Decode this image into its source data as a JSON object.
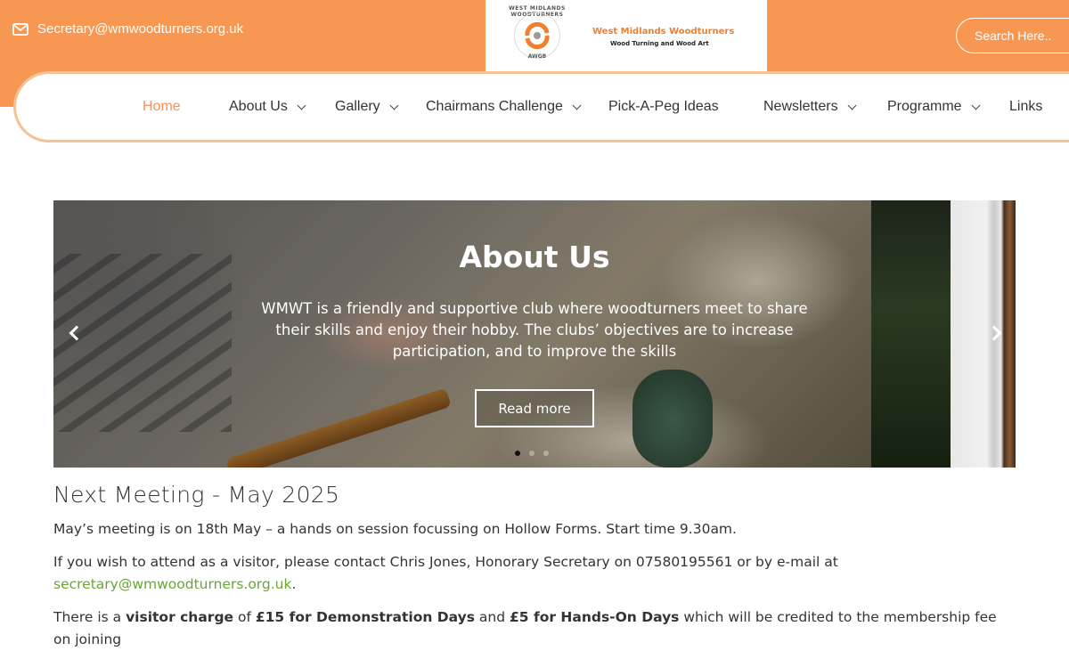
{
  "header": {
    "email": "Secretary@wmwoodturners.org.uk",
    "search_placeholder": "Search Here..",
    "logo": {
      "ring_top": "WEST MIDLANDS WOODTURNERS",
      "ring_bottom": "AWGB",
      "title": "West Midlands Woodturners",
      "subtitle": "Wood Turning and Wood Art"
    },
    "brand_color": "#f89752"
  },
  "nav": {
    "items": [
      {
        "label": "Home",
        "active": true,
        "dropdown": false
      },
      {
        "label": "About Us",
        "dropdown": true
      },
      {
        "label": "Gallery",
        "dropdown": true
      },
      {
        "label": "Chairmans Challenge",
        "dropdown": true
      },
      {
        "label": "Pick-A-Peg Ideas",
        "dropdown": false
      },
      {
        "label": "Newsletters",
        "dropdown": true
      },
      {
        "label": "Programme",
        "dropdown": true
      },
      {
        "label": "Links",
        "dropdown": false
      }
    ]
  },
  "hero": {
    "title": "About Us",
    "text": "WMWT is a friendly and supportive club where woodturners meet to share their skills and enjoy their hobby. The clubs’ objectives are to increase participation, and to improve the skills",
    "button": "Read more",
    "slides": 3,
    "active_slide": 1
  },
  "content": {
    "title": "Next Meeting - May 2025",
    "p1": "May’s meeting is on 18th May – a hands on session focussing on Hollow Forms. Start time 9.30am.",
    "p2_text": "If you wish to attend as a visitor, please contact Chris Jones, Honorary Secretary on 07580195561 or by e-mail at",
    "p2_link": "secretary@wmwoodturners.org.uk",
    "p2_end": ".",
    "p3": {
      "a": "There is a ",
      "b1": "visitor charge",
      "c": " of ",
      "b2": "£15 for Demonstration Days",
      "d": " and ",
      "b3": "£5 for Hands-On Days",
      "e": " which will be credited to the membership fee on joining"
    }
  }
}
